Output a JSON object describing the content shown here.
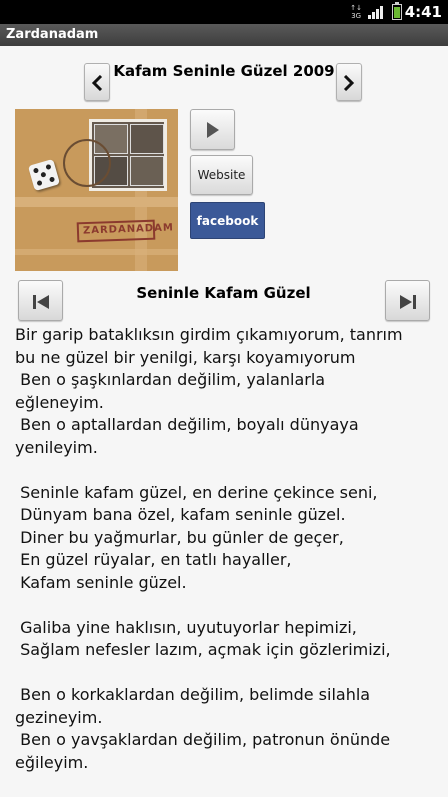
{
  "status": {
    "time": "4:41",
    "network": "3G"
  },
  "app": {
    "title": "Zardanadam"
  },
  "album": {
    "title": "Kafam Seninle Güzel 2009",
    "cover_brand": "ZARDANADAM"
  },
  "actions": {
    "website_label": "Website",
    "facebook_label": "facebook"
  },
  "song": {
    "title": "Seninle Kafam Güzel"
  },
  "lyrics": [
    "Bir garip bataklıksın girdim çıkamıyorum, tanrım",
    "bu ne güzel bir yenilgi, karşı koyamıyorum",
    " Ben o şaşkınlardan değilim, yalanlarla",
    "eğleneyim.",
    " Ben o aptallardan değilim, boyalı dünyaya",
    "yenileyim.",
    "",
    " Seninle kafam güzel, en derine çekince seni,",
    " Dünyam bana özel, kafam seninle güzel.",
    " Diner bu yağmurlar, bu günler de geçer,",
    " En güzel rüyalar, en tatlı hayaller,",
    " Kafam seninle güzel.",
    "",
    " Galiba yine haklısın, uyutuyorlar hepimizi,",
    " Sağlam nefesler lazım, açmak için gözlerimizi,",
    "",
    " Ben o korkaklardan değilim, belimde silahla",
    "gezineyim.",
    " Ben o yavşaklardan değilim, patronun önünde",
    "eğileyim."
  ],
  "colors": {
    "facebook": "#3b5998",
    "battery": "#6bb833",
    "titlebar": "#4a4a4a"
  }
}
